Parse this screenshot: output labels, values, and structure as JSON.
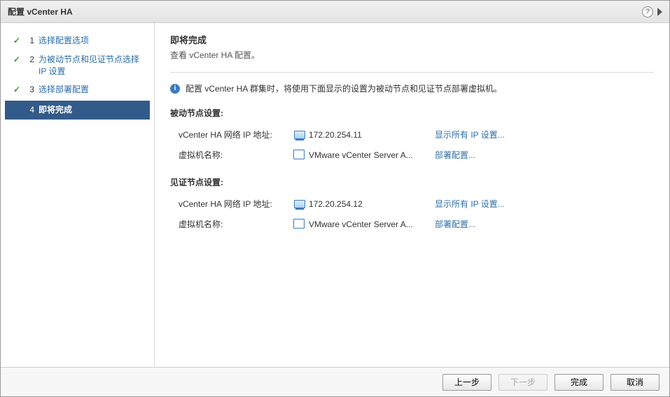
{
  "title": "配置 vCenter HA",
  "sidebar": {
    "steps": [
      {
        "num": "1",
        "label": "选择配置选项",
        "done": true,
        "active": false
      },
      {
        "num": "2",
        "label": "为被动节点和见证节点选择 IP 设置",
        "done": true,
        "active": false
      },
      {
        "num": "3",
        "label": "选择部署配置",
        "done": true,
        "active": false
      },
      {
        "num": "4",
        "label": "即将完成",
        "done": false,
        "active": true
      }
    ]
  },
  "main": {
    "heading": "即将完成",
    "subheading": "查看 vCenter HA 配置。",
    "info_text": "配置 vCenter HA 群集时，将使用下面显示的设置为被动节点和见证节点部署虚拟机。",
    "passive": {
      "title": "被动节点设置:",
      "ip_label": "vCenter HA 网络 IP 地址:",
      "ip_value": "172.20.254.11",
      "ip_link": "显示所有 IP 设置...",
      "vm_label": "虚拟机名称:",
      "vm_value": "VMware vCenter Server A...",
      "vm_link": "部署配置..."
    },
    "witness": {
      "title": "见证节点设置:",
      "ip_label": "vCenter HA 网络 IP 地址:",
      "ip_value": "172.20.254.12",
      "ip_link": "显示所有 IP 设置...",
      "vm_label": "虚拟机名称:",
      "vm_value": "VMware vCenter Server A...",
      "vm_link": "部署配置..."
    }
  },
  "footer": {
    "back": "上一步",
    "next": "下一步",
    "finish": "完成",
    "cancel": "取消"
  }
}
